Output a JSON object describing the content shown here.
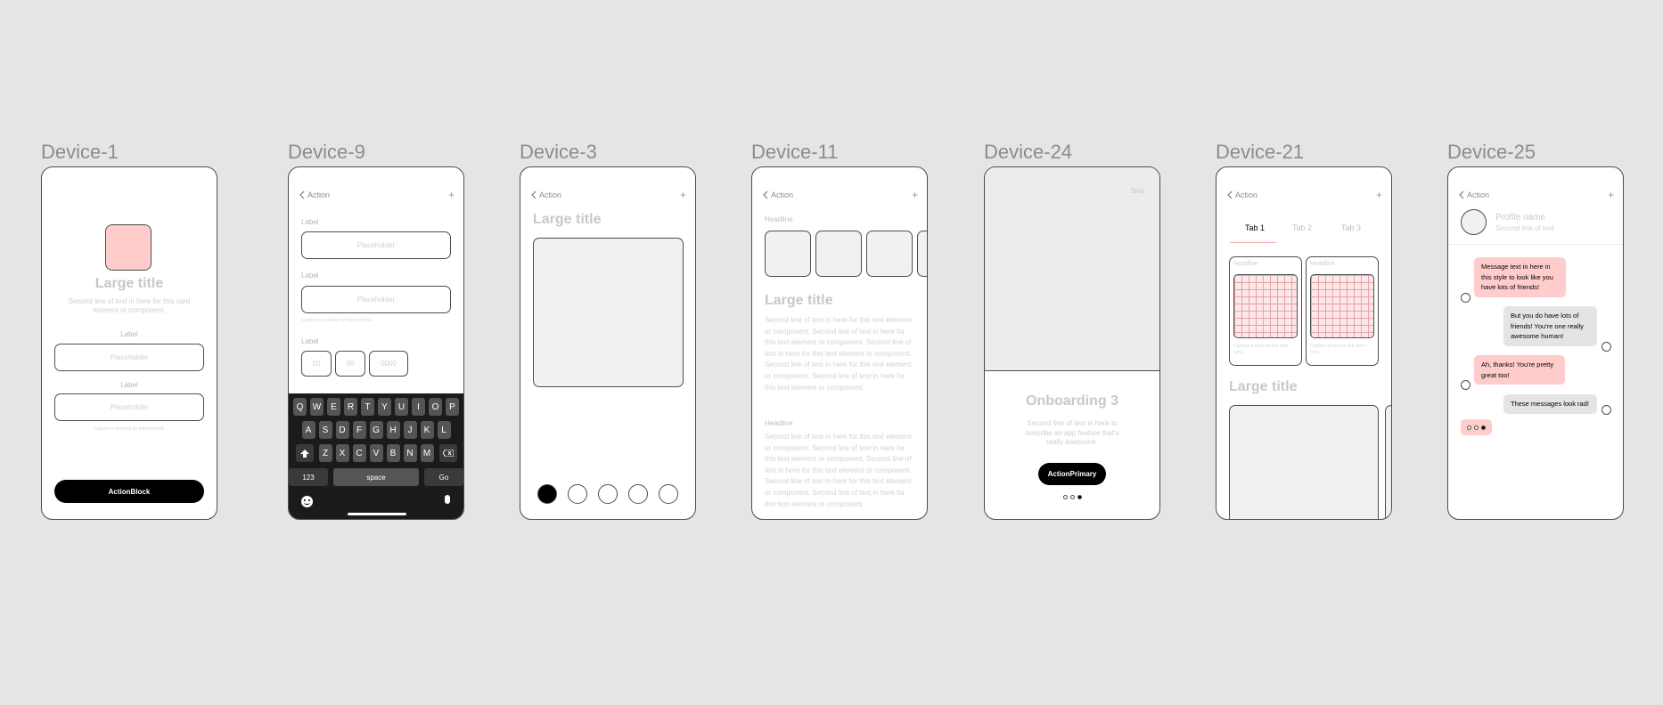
{
  "devices": [
    {
      "id": "device-1",
      "label": "Device-1"
    },
    {
      "id": "device-9",
      "label": "Device-9"
    },
    {
      "id": "device-3",
      "label": "Device-3"
    },
    {
      "id": "device-11",
      "label": "Device-11"
    },
    {
      "id": "device-24",
      "label": "Device-24"
    },
    {
      "id": "device-21",
      "label": "Device-21"
    },
    {
      "id": "device-25",
      "label": "Device-25"
    }
  ],
  "nav": {
    "back_label": "Action",
    "add_label": "+"
  },
  "device1": {
    "title": "Large title",
    "subtitle": "Second line of text in here for this card element or component.",
    "field1_label": "Label",
    "field1_placeholder": "Placeholder",
    "field2_label": "Label",
    "field2_placeholder": "Placeholder",
    "hint": "Caption or warning for this text field.",
    "button": "ActionBlock"
  },
  "device9": {
    "field1_label": "Label",
    "field1_placeholder": "Placeholder",
    "field2_label": "Label",
    "field2_placeholder": "Placeholder",
    "field2_hint": "Caption or warning for this text field.",
    "date_label": "Label",
    "date_day": "00",
    "date_month": "00",
    "date_year": "0000",
    "keyboard": {
      "row1": [
        "Q",
        "W",
        "E",
        "R",
        "T",
        "Y",
        "U",
        "I",
        "O",
        "P"
      ],
      "row2": [
        "A",
        "S",
        "D",
        "F",
        "G",
        "H",
        "J",
        "K",
        "L"
      ],
      "row3": [
        "Z",
        "X",
        "C",
        "V",
        "B",
        "N",
        "M"
      ],
      "numbers": "123",
      "space": "space",
      "go": "Go"
    }
  },
  "device3": {
    "title": "Large title",
    "active_page": 1,
    "page_count": 5
  },
  "device11": {
    "headline1": "Headline",
    "title": "Large title",
    "paragraph1": "Second line of text in here for this text element or component. Second line of text in here for this text element or component. Second line of text in here for this text element or component. Second line of text in here for this text element or component. Second line of text in here for this text element or component.",
    "headline2": "Headline",
    "paragraph2": "Second line of text in here for this text element or component. Second line of text in here for this text element or component. Second line of text in here for this text element or component. Second line of text in here for this text element or component. Second line of text in here for this text element or component."
  },
  "device24": {
    "skip": "Skip",
    "title": "Onboarding 3",
    "subtitle": "Second line of text in here to describe an app feature that's really awesome.",
    "button": "ActionPrimary",
    "active_step": 3,
    "step_count": 3
  },
  "device21": {
    "tabs": [
      "Tab 1",
      "Tab 2",
      "Tab 3"
    ],
    "active_tab": 0,
    "cards": [
      {
        "headline": "Headline",
        "caption": "Caption in here for this item card."
      },
      {
        "headline": "Headline",
        "caption": "Caption in here for this item card."
      }
    ],
    "title": "Large title"
  },
  "device25": {
    "profile_name": "Profile name",
    "profile_sub": "Second line of text",
    "messages": [
      {
        "from": "them",
        "text": "Message text in here in this style to look like you have lots of friends!"
      },
      {
        "from": "me",
        "text": "But you do have lots of friends! You're one really awesome human!"
      },
      {
        "from": "them",
        "text": "Ah, thanks! You're pretty great too!"
      },
      {
        "from": "me",
        "text": "These messages look rad!"
      }
    ]
  },
  "colors": {
    "background": "#e5e5e5",
    "accent_pink": "#ffcccc",
    "tab_indicator": "#f4a7ab",
    "outline": "#4d4d4d",
    "primary_button": "#000000"
  }
}
